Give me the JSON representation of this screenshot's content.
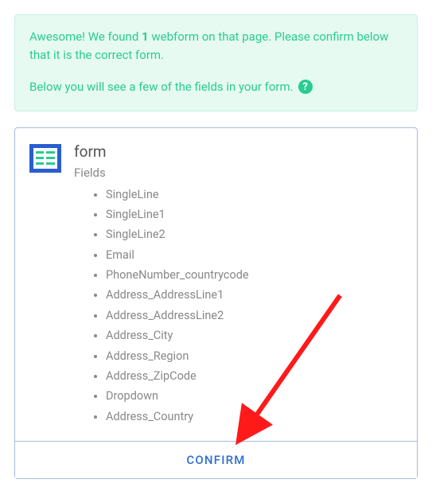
{
  "alert": {
    "prefix": "Awesome! We found ",
    "count": "1",
    "after_count": " webform on that page. Please confirm below that it is the correct form.",
    "secondary": "Below you will see a few of the fields in your form.",
    "help_icon_label": "?"
  },
  "form": {
    "title": "form",
    "fields_label": "Fields",
    "fields": [
      "SingleLine",
      "SingleLine1",
      "SingleLine2",
      "Email",
      "PhoneNumber_countrycode",
      "Address_AddressLine1",
      "Address_AddressLine2",
      "Address_City",
      "Address_Region",
      "Address_ZipCode",
      "Dropdown",
      "Address_Country"
    ]
  },
  "confirm_label": "CONFIRM",
  "colors": {
    "accent_green": "#29cc94",
    "border_blue": "#a4bde0",
    "btn_blue": "#2f6fd0",
    "arrow_red": "#ff1a1a"
  }
}
